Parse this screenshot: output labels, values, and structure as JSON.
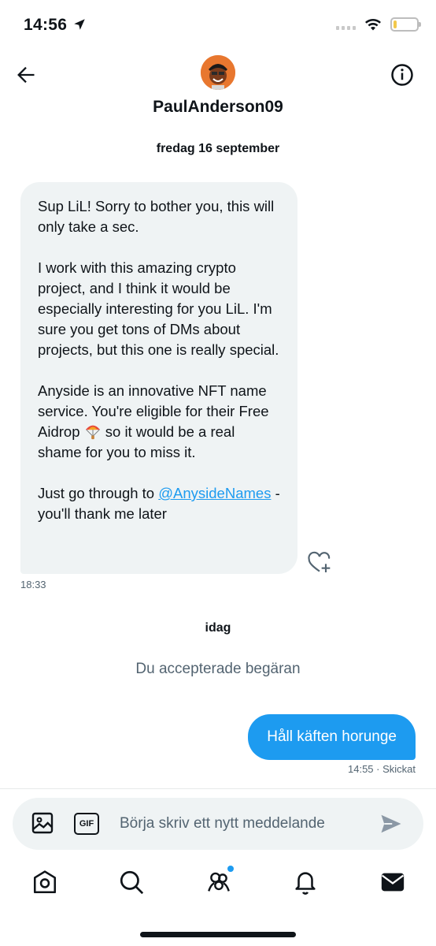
{
  "status_bar": {
    "time": "14:56",
    "battery_level": 0.15,
    "battery_color": "#f2c84b"
  },
  "header": {
    "username": "PaulAnderson09",
    "back_icon": "arrow-left-icon",
    "info_icon": "info-icon"
  },
  "conversation": {
    "date_1": "fredag 16 september",
    "incoming": {
      "para1": "Sup LiL! Sorry to bother you, this will only take a sec.",
      "para2": "I work with this amazing crypto project, and I think it would be especially interesting for you LiL. I'm sure you get tons of DMs about projects, but this one is really special.",
      "para3_a": "Anyside is an innovative NFT name service. You're eligible for their Free Aidrop ",
      "para3_b": " so it would be a real shame for you to miss it.",
      "para4_a": "Just go through to ",
      "mention": "@AnysideNames",
      "para4_b": " - you'll thank me later",
      "time": "18:33"
    },
    "date_2": "idag",
    "system_message": "Du accepterade begäran",
    "outgoing": {
      "text": "Håll käften horunge",
      "meta": "14:55 · Skickat"
    }
  },
  "composer": {
    "placeholder": "Börja skriv ett nytt meddelande",
    "gif_label": "GIF"
  },
  "tabbar": {
    "items": [
      "home-icon",
      "search-icon",
      "communities-icon",
      "bell-icon",
      "mail-icon"
    ],
    "accent": "#1d9bf0"
  }
}
